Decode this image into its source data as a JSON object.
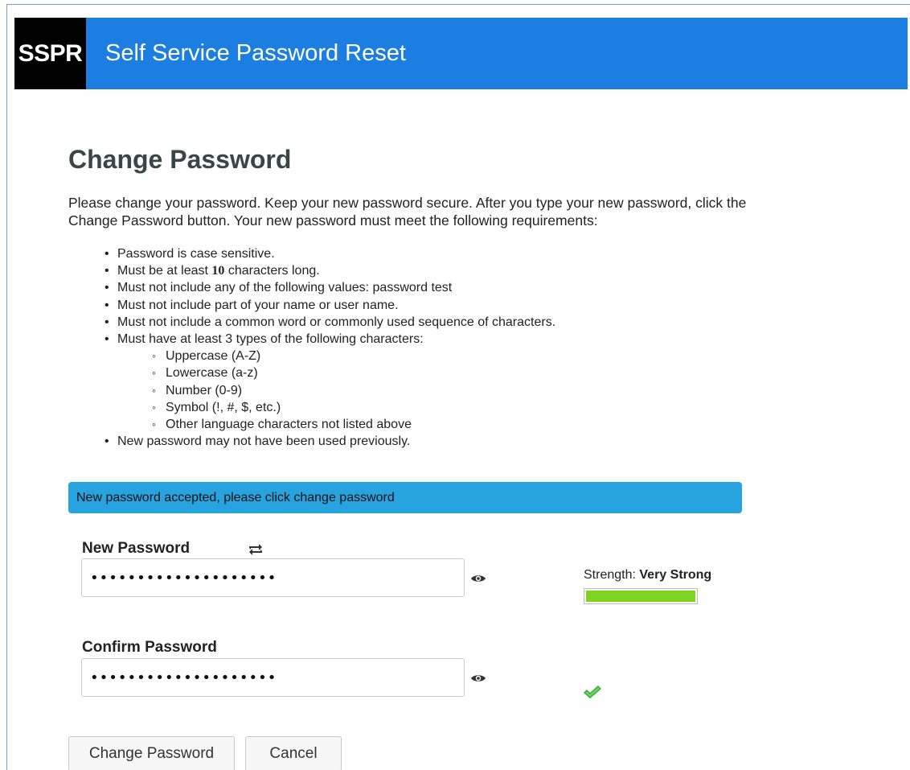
{
  "header": {
    "logo": "SSPR",
    "title": "Self Service Password Reset",
    "background": "#1b7ee0"
  },
  "page": {
    "title": "Change Password",
    "intro": "Please change your password. Keep your new password secure. After you type your new password, click the Change Password button. Your new password must meet the following requirements:"
  },
  "requirements": {
    "items": [
      "Password is case sensitive.",
      "Must be at least",
      "10",
      "characters long.",
      "Must not include any of the following values:  password test",
      "Must not include part of your name or user name.",
      "Must not include a common word or commonly used sequence of characters.",
      "Must have at least 3 types of the following characters:",
      "New password may not have been used previously."
    ],
    "char_types": [
      "Uppercase (A-Z)",
      "Lowercase (a-z)",
      "Number (0-9)",
      "Symbol (!, #, $, etc.)",
      "Other language characters not listed above"
    ]
  },
  "status": {
    "message": "New password accepted, please click change password",
    "color": "#27a3df"
  },
  "new_password": {
    "label": "New Password",
    "value": "••••••••••••••••••••",
    "regenerate_icon": "random-icon",
    "show_icon": "eye-icon"
  },
  "confirm_password": {
    "label": "Confirm Password",
    "value": "••••••••••••••••••••",
    "show_icon": "eye-icon",
    "match_icon": "checkmark-icon"
  },
  "strength": {
    "label": "Strength:",
    "value": "Very Strong",
    "level": 1.0,
    "color": "#7ed321"
  },
  "buttons": {
    "change": "Change Password",
    "cancel": "Cancel"
  }
}
